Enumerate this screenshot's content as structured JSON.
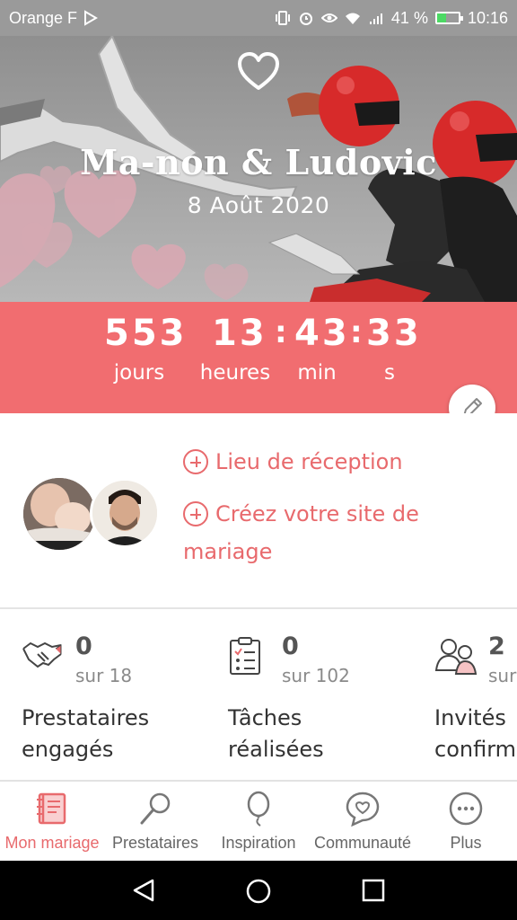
{
  "status_bar": {
    "carrier": "Orange F",
    "battery_percent": "41 %",
    "battery_level": 0.41,
    "time": "10:16",
    "icons": [
      "vibrate-icon",
      "alarm-icon",
      "eye-icon",
      "wifi-icon",
      "signal-icon",
      "battery-icon"
    ]
  },
  "hero": {
    "couple_names": "Ma-non & Ludovic",
    "wedding_date": "8 Août 2020",
    "top_icon": "heart-icon"
  },
  "countdown": {
    "days_value": "553",
    "days_label": "jours",
    "hours_value": "13",
    "hours_label": "heures",
    "minutes_value": "43",
    "minutes_label": "min",
    "seconds_value": "33",
    "seconds_label": "s",
    "separator": ":",
    "edit_icon": "pencil-icon"
  },
  "couple": {
    "link_reception": "Lieu de réception",
    "link_site_line1": "Créez votre site de",
    "link_site_line2": "mariage"
  },
  "stats": [
    {
      "count": "0",
      "total": "sur 18",
      "label_line1": "Prestataires",
      "label_line2": "engagés",
      "icon": "handshake-icon"
    },
    {
      "count": "0",
      "total": "sur 102",
      "label_line1": "Tâches",
      "label_line2": "réalisées",
      "icon": "checklist-icon"
    },
    {
      "count": "2",
      "total": "sur",
      "label_line1": "Invités",
      "label_line2": "confirm",
      "icon": "guests-icon"
    }
  ],
  "bottom_nav": [
    {
      "label": "Mon mariage",
      "icon": "notebook-icon",
      "active": true
    },
    {
      "label": "Prestataires",
      "icon": "magnifier-icon",
      "active": false
    },
    {
      "label": "Inspiration",
      "icon": "balloon-icon",
      "active": false
    },
    {
      "label": "Communauté",
      "icon": "chat-heart-icon",
      "active": false
    },
    {
      "label": "Plus",
      "icon": "more-icon",
      "active": false
    }
  ],
  "colors": {
    "accent": "#f16d70",
    "accent_text": "#e86a6d",
    "status_bar": "#9a9a9a"
  }
}
